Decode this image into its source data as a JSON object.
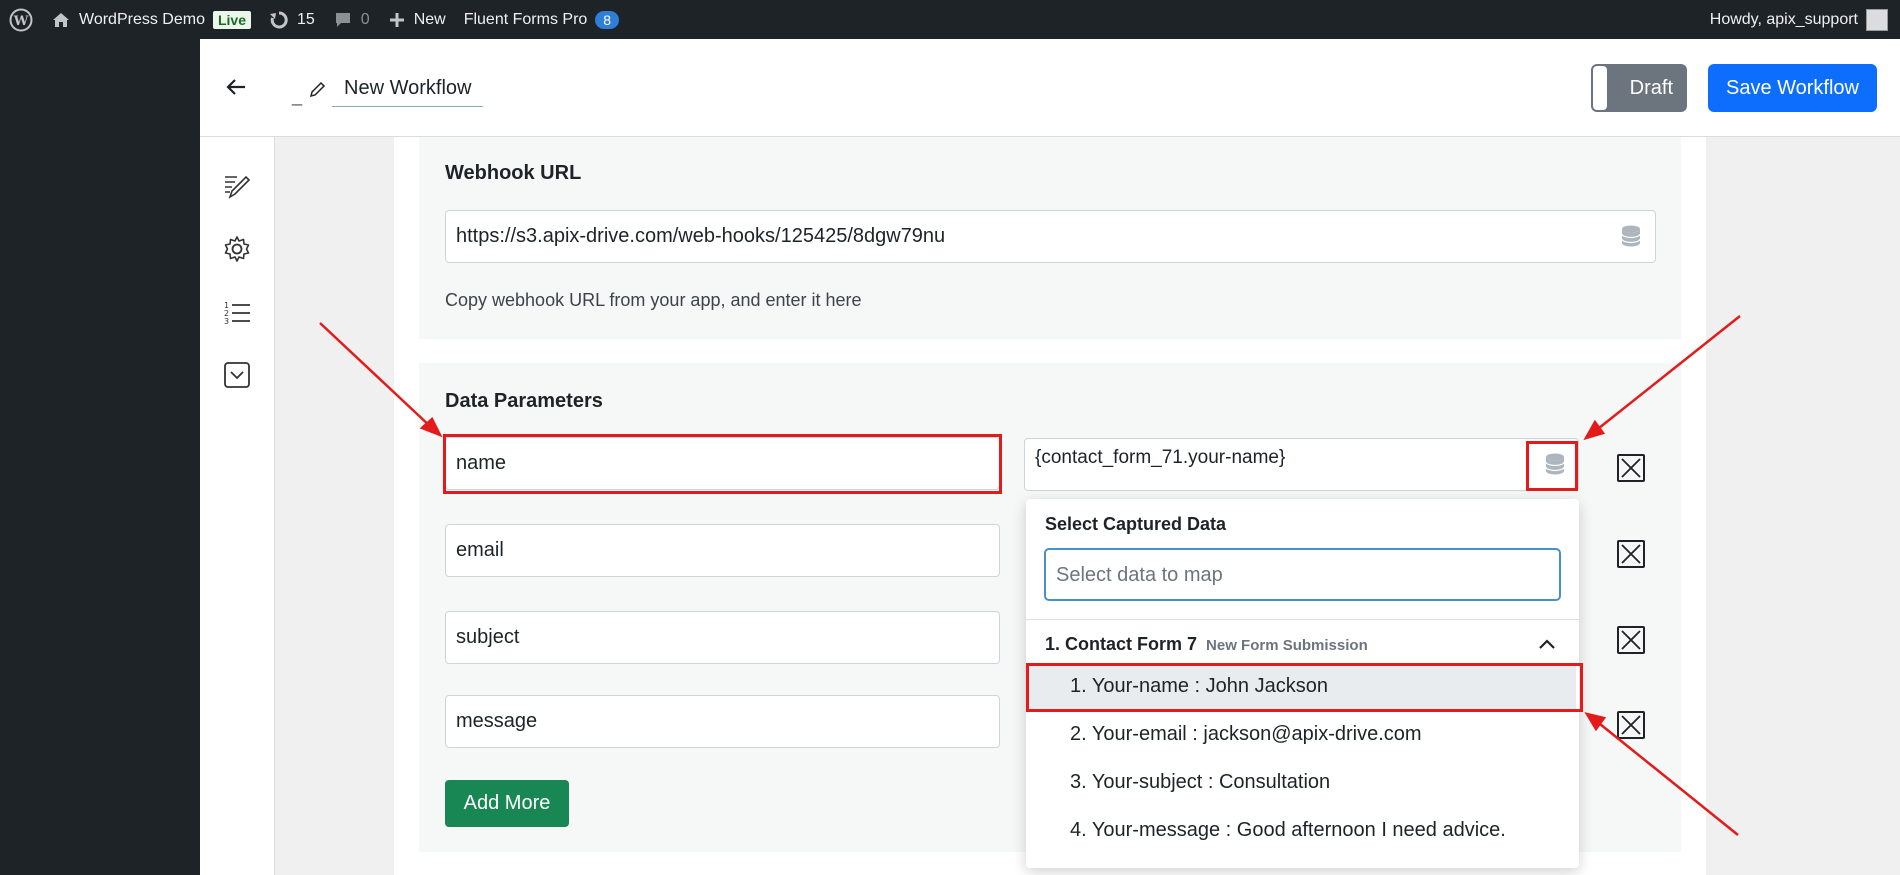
{
  "adminbar": {
    "site_name": "WordPress Demo",
    "live_badge": "Live",
    "updates_count": "15",
    "comments_count": "0",
    "new_label": "New",
    "plugin_label": "Fluent Forms Pro",
    "plugin_badge": "8",
    "howdy": "Howdy, apix_support"
  },
  "header": {
    "title_prefix": "_",
    "title": "New Workflow",
    "draft_label": "Draft",
    "save_label": "Save Workflow"
  },
  "webhook": {
    "title": "Webhook URL",
    "url_value": "https://s3.apix-drive.com/web-hooks/125425/8dgw79nu",
    "hint": "Copy webhook URL from your app, and enter it here"
  },
  "data_params": {
    "title": "Data Parameters",
    "rows": [
      {
        "key": "name",
        "value": "{contact_form_71.your-name}"
      },
      {
        "key": "email"
      },
      {
        "key": "subject"
      },
      {
        "key": "message"
      }
    ],
    "add_more_label": "Add More"
  },
  "dropdown": {
    "title": "Select Captured Data",
    "search_placeholder": "Select data to map",
    "group_label": "1. Contact Form 7",
    "group_sub": "New Form Submission",
    "items": [
      "1. Your-name : John Jackson",
      "2. Your-email : jackson@apix-drive.com",
      "3. Your-subject : Consultation",
      "4. Your-message : Good afternoon I need advice."
    ]
  },
  "colors": {
    "accent": "#0d6efd",
    "success": "#198754",
    "annotation": "#e31b1b",
    "adminbar": "#1d2327"
  }
}
